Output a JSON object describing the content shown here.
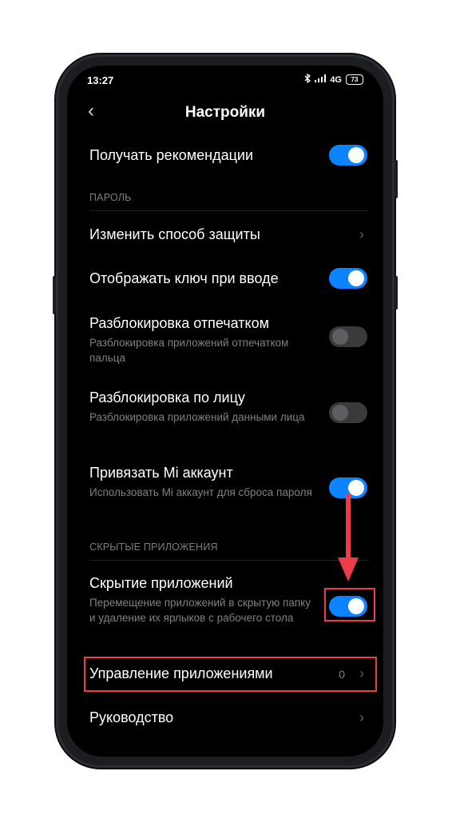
{
  "status": {
    "time": "13:27",
    "network": "4G",
    "battery": "73"
  },
  "header": {
    "back": "‹",
    "title": "Настройки"
  },
  "sections": {
    "password": "ПАРОЛЬ",
    "hidden": "СКРЫТЫЕ ПРИЛОЖЕНИЯ"
  },
  "items": {
    "recommendations": {
      "title": "Получать рекомендации",
      "enabled": true
    },
    "protection": {
      "title": "Изменить способ защиты"
    },
    "show_key": {
      "title": "Отображать ключ при вводе",
      "enabled": true
    },
    "fingerprint": {
      "title": "Разблокировка отпечатком",
      "subtitle": "Разблокировка приложений отпечатком пальца",
      "enabled": false
    },
    "face": {
      "title": "Разблокировка по лицу",
      "subtitle": "Разблокировка приложений данными лица",
      "enabled": false
    },
    "mi_account": {
      "title": "Привязать Mi аккаунт",
      "subtitle": "Использовать Mi аккаунт для сброса пароля",
      "enabled": true
    },
    "hide_apps": {
      "title": "Скрытие приложений",
      "subtitle": "Перемещение приложений в скрытую папку и удаление их ярлыков с рабочего стола",
      "enabled": true
    },
    "manage_apps": {
      "title": "Управление приложениями",
      "count": "0"
    },
    "guide": {
      "title": "Руководство"
    }
  },
  "chevron": "›",
  "colors": {
    "accent": "#0d84ff",
    "highlight": "#ec3b49"
  }
}
